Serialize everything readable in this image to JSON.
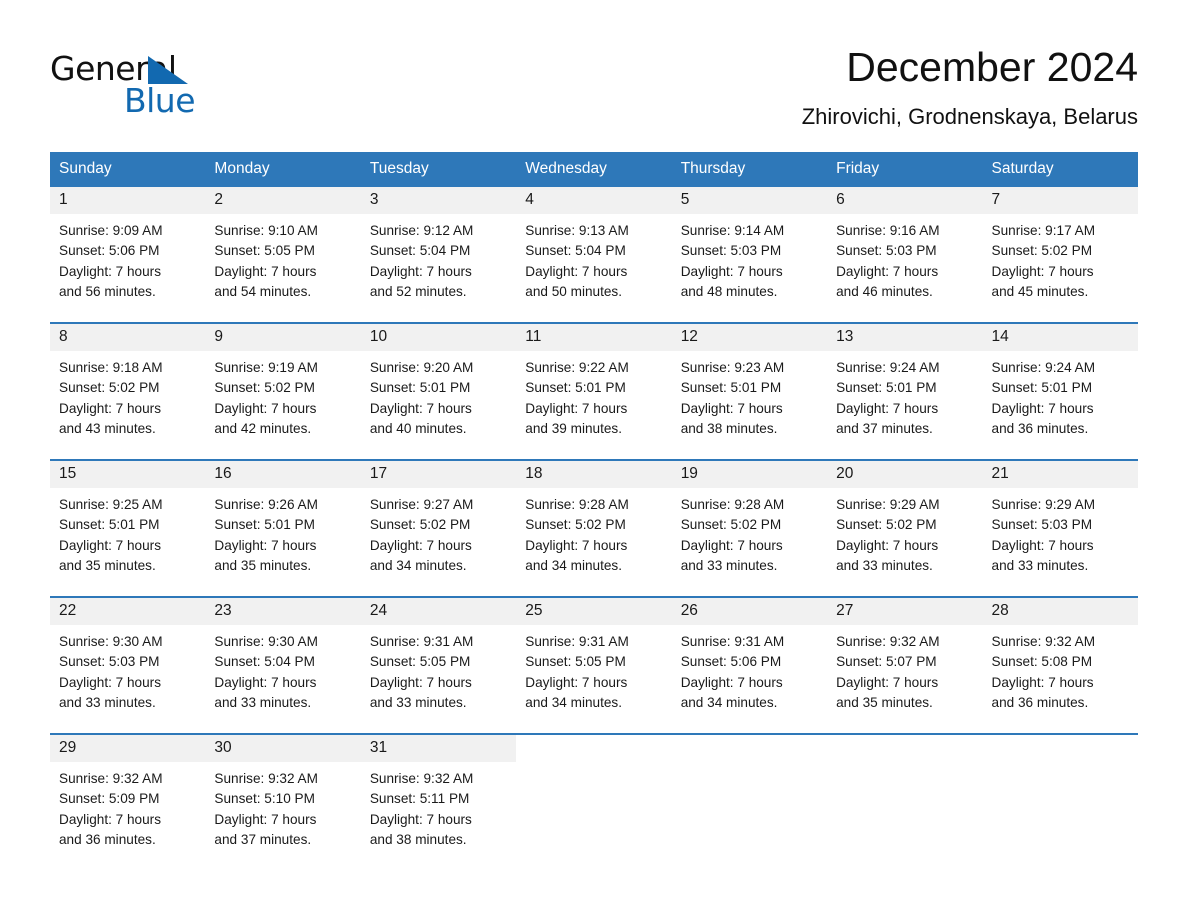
{
  "brand": {
    "name_part1": "General",
    "name_part2": "Blue",
    "accent_color": "#1269b0"
  },
  "header": {
    "title": "December 2024",
    "location": "Zhirovichi, Grodnenskaya, Belarus"
  },
  "theme": {
    "header_blue": "#2e78b9",
    "daynum_gray": "#f1f1f1",
    "text": "#1a1a1a"
  },
  "calendar": {
    "weekday_headers": [
      "Sunday",
      "Monday",
      "Tuesday",
      "Wednesday",
      "Thursday",
      "Friday",
      "Saturday"
    ],
    "weeks": [
      [
        {
          "day": "1",
          "sunrise": "Sunrise: 9:09 AM",
          "sunset": "Sunset: 5:06 PM",
          "daylight1": "Daylight: 7 hours",
          "daylight2": "and 56 minutes."
        },
        {
          "day": "2",
          "sunrise": "Sunrise: 9:10 AM",
          "sunset": "Sunset: 5:05 PM",
          "daylight1": "Daylight: 7 hours",
          "daylight2": "and 54 minutes."
        },
        {
          "day": "3",
          "sunrise": "Sunrise: 9:12 AM",
          "sunset": "Sunset: 5:04 PM",
          "daylight1": "Daylight: 7 hours",
          "daylight2": "and 52 minutes."
        },
        {
          "day": "4",
          "sunrise": "Sunrise: 9:13 AM",
          "sunset": "Sunset: 5:04 PM",
          "daylight1": "Daylight: 7 hours",
          "daylight2": "and 50 minutes."
        },
        {
          "day": "5",
          "sunrise": "Sunrise: 9:14 AM",
          "sunset": "Sunset: 5:03 PM",
          "daylight1": "Daylight: 7 hours",
          "daylight2": "and 48 minutes."
        },
        {
          "day": "6",
          "sunrise": "Sunrise: 9:16 AM",
          "sunset": "Sunset: 5:03 PM",
          "daylight1": "Daylight: 7 hours",
          "daylight2": "and 46 minutes."
        },
        {
          "day": "7",
          "sunrise": "Sunrise: 9:17 AM",
          "sunset": "Sunset: 5:02 PM",
          "daylight1": "Daylight: 7 hours",
          "daylight2": "and 45 minutes."
        }
      ],
      [
        {
          "day": "8",
          "sunrise": "Sunrise: 9:18 AM",
          "sunset": "Sunset: 5:02 PM",
          "daylight1": "Daylight: 7 hours",
          "daylight2": "and 43 minutes."
        },
        {
          "day": "9",
          "sunrise": "Sunrise: 9:19 AM",
          "sunset": "Sunset: 5:02 PM",
          "daylight1": "Daylight: 7 hours",
          "daylight2": "and 42 minutes."
        },
        {
          "day": "10",
          "sunrise": "Sunrise: 9:20 AM",
          "sunset": "Sunset: 5:01 PM",
          "daylight1": "Daylight: 7 hours",
          "daylight2": "and 40 minutes."
        },
        {
          "day": "11",
          "sunrise": "Sunrise: 9:22 AM",
          "sunset": "Sunset: 5:01 PM",
          "daylight1": "Daylight: 7 hours",
          "daylight2": "and 39 minutes."
        },
        {
          "day": "12",
          "sunrise": "Sunrise: 9:23 AM",
          "sunset": "Sunset: 5:01 PM",
          "daylight1": "Daylight: 7 hours",
          "daylight2": "and 38 minutes."
        },
        {
          "day": "13",
          "sunrise": "Sunrise: 9:24 AM",
          "sunset": "Sunset: 5:01 PM",
          "daylight1": "Daylight: 7 hours",
          "daylight2": "and 37 minutes."
        },
        {
          "day": "14",
          "sunrise": "Sunrise: 9:24 AM",
          "sunset": "Sunset: 5:01 PM",
          "daylight1": "Daylight: 7 hours",
          "daylight2": "and 36 minutes."
        }
      ],
      [
        {
          "day": "15",
          "sunrise": "Sunrise: 9:25 AM",
          "sunset": "Sunset: 5:01 PM",
          "daylight1": "Daylight: 7 hours",
          "daylight2": "and 35 minutes."
        },
        {
          "day": "16",
          "sunrise": "Sunrise: 9:26 AM",
          "sunset": "Sunset: 5:01 PM",
          "daylight1": "Daylight: 7 hours",
          "daylight2": "and 35 minutes."
        },
        {
          "day": "17",
          "sunrise": "Sunrise: 9:27 AM",
          "sunset": "Sunset: 5:02 PM",
          "daylight1": "Daylight: 7 hours",
          "daylight2": "and 34 minutes."
        },
        {
          "day": "18",
          "sunrise": "Sunrise: 9:28 AM",
          "sunset": "Sunset: 5:02 PM",
          "daylight1": "Daylight: 7 hours",
          "daylight2": "and 34 minutes."
        },
        {
          "day": "19",
          "sunrise": "Sunrise: 9:28 AM",
          "sunset": "Sunset: 5:02 PM",
          "daylight1": "Daylight: 7 hours",
          "daylight2": "and 33 minutes."
        },
        {
          "day": "20",
          "sunrise": "Sunrise: 9:29 AM",
          "sunset": "Sunset: 5:02 PM",
          "daylight1": "Daylight: 7 hours",
          "daylight2": "and 33 minutes."
        },
        {
          "day": "21",
          "sunrise": "Sunrise: 9:29 AM",
          "sunset": "Sunset: 5:03 PM",
          "daylight1": "Daylight: 7 hours",
          "daylight2": "and 33 minutes."
        }
      ],
      [
        {
          "day": "22",
          "sunrise": "Sunrise: 9:30 AM",
          "sunset": "Sunset: 5:03 PM",
          "daylight1": "Daylight: 7 hours",
          "daylight2": "and 33 minutes."
        },
        {
          "day": "23",
          "sunrise": "Sunrise: 9:30 AM",
          "sunset": "Sunset: 5:04 PM",
          "daylight1": "Daylight: 7 hours",
          "daylight2": "and 33 minutes."
        },
        {
          "day": "24",
          "sunrise": "Sunrise: 9:31 AM",
          "sunset": "Sunset: 5:05 PM",
          "daylight1": "Daylight: 7 hours",
          "daylight2": "and 33 minutes."
        },
        {
          "day": "25",
          "sunrise": "Sunrise: 9:31 AM",
          "sunset": "Sunset: 5:05 PM",
          "daylight1": "Daylight: 7 hours",
          "daylight2": "and 34 minutes."
        },
        {
          "day": "26",
          "sunrise": "Sunrise: 9:31 AM",
          "sunset": "Sunset: 5:06 PM",
          "daylight1": "Daylight: 7 hours",
          "daylight2": "and 34 minutes."
        },
        {
          "day": "27",
          "sunrise": "Sunrise: 9:32 AM",
          "sunset": "Sunset: 5:07 PM",
          "daylight1": "Daylight: 7 hours",
          "daylight2": "and 35 minutes."
        },
        {
          "day": "28",
          "sunrise": "Sunrise: 9:32 AM",
          "sunset": "Sunset: 5:08 PM",
          "daylight1": "Daylight: 7 hours",
          "daylight2": "and 36 minutes."
        }
      ],
      [
        {
          "day": "29",
          "sunrise": "Sunrise: 9:32 AM",
          "sunset": "Sunset: 5:09 PM",
          "daylight1": "Daylight: 7 hours",
          "daylight2": "and 36 minutes."
        },
        {
          "day": "30",
          "sunrise": "Sunrise: 9:32 AM",
          "sunset": "Sunset: 5:10 PM",
          "daylight1": "Daylight: 7 hours",
          "daylight2": "and 37 minutes."
        },
        {
          "day": "31",
          "sunrise": "Sunrise: 9:32 AM",
          "sunset": "Sunset: 5:11 PM",
          "daylight1": "Daylight: 7 hours",
          "daylight2": "and 38 minutes."
        },
        {
          "day": "",
          "sunrise": "",
          "sunset": "",
          "daylight1": "",
          "daylight2": ""
        },
        {
          "day": "",
          "sunrise": "",
          "sunset": "",
          "daylight1": "",
          "daylight2": ""
        },
        {
          "day": "",
          "sunrise": "",
          "sunset": "",
          "daylight1": "",
          "daylight2": ""
        },
        {
          "day": "",
          "sunrise": "",
          "sunset": "",
          "daylight1": "",
          "daylight2": ""
        }
      ]
    ]
  }
}
